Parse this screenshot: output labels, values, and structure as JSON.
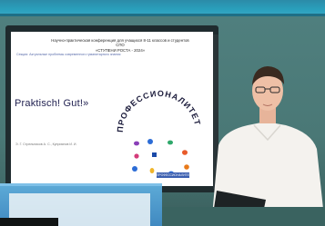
{
  "slide": {
    "header_line1": "Научно-практическая конференция для учащихся 8-11 классов и студентов СПО",
    "header_line2": "«СТУПЕНИ РОСТА - 2024»",
    "subline": "Секция: Актуальные проблемы современного гуманитарного знания",
    "title": "Praktisch! Gut!»",
    "caption": "Э. Г. Стрельников А. С., Куприянов И. И.",
    "arc_text": "ПРОФЕССИОНАЛИТЕТ",
    "logo_text": "ПРОФЕССИОНАЛИТЕТ"
  },
  "colors": {
    "wall": "#4a7876",
    "frame": "#2aa0bd",
    "shirt": "#f4f2ee",
    "folder": "#1e2325"
  }
}
